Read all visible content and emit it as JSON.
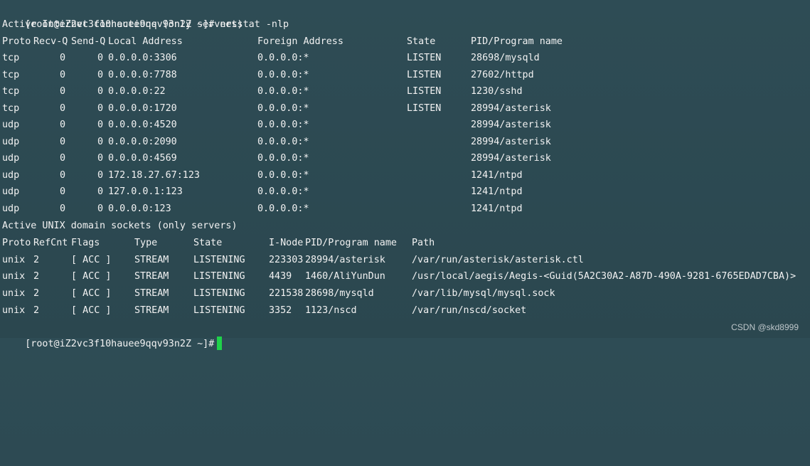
{
  "prompt": "[root@iZ2vc3f10hauee9qqv93n2Z ~]#",
  "command": "netstat -nlp",
  "inet_header": "Active Internet connections (only servers)",
  "inet_columns": [
    "Proto",
    "Recv-Q",
    "Send-Q",
    "Local Address",
    "Foreign Address",
    "State",
    "PID/Program name"
  ],
  "inet_rows": [
    [
      "tcp",
      "0",
      "0",
      "0.0.0.0:3306",
      "0.0.0.0:*",
      "LISTEN",
      "28698/mysqld"
    ],
    [
      "tcp",
      "0",
      "0",
      "0.0.0.0:7788",
      "0.0.0.0:*",
      "LISTEN",
      "27602/httpd"
    ],
    [
      "tcp",
      "0",
      "0",
      "0.0.0.0:22",
      "0.0.0.0:*",
      "LISTEN",
      "1230/sshd"
    ],
    [
      "tcp",
      "0",
      "0",
      "0.0.0.0:1720",
      "0.0.0.0:*",
      "LISTEN",
      "28994/asterisk"
    ],
    [
      "udp",
      "0",
      "0",
      "0.0.0.0:4520",
      "0.0.0.0:*",
      "",
      "28994/asterisk"
    ],
    [
      "udp",
      "0",
      "0",
      "0.0.0.0:2090",
      "0.0.0.0:*",
      "",
      "28994/asterisk"
    ],
    [
      "udp",
      "0",
      "0",
      "0.0.0.0:4569",
      "0.0.0.0:*",
      "",
      "28994/asterisk"
    ],
    [
      "udp",
      "0",
      "0",
      "172.18.27.67:123",
      "0.0.0.0:*",
      "",
      "1241/ntpd"
    ],
    [
      "udp",
      "0",
      "0",
      "127.0.0.1:123",
      "0.0.0.0:*",
      "",
      "1241/ntpd"
    ],
    [
      "udp",
      "0",
      "0",
      "0.0.0.0:123",
      "0.0.0.0:*",
      "",
      "1241/ntpd"
    ]
  ],
  "unix_header": "Active UNIX domain sockets (only servers)",
  "unix_columns": [
    "Proto",
    "RefCnt",
    "Flags",
    "Type",
    "State",
    "I-Node",
    "PID/Program name",
    "Path"
  ],
  "unix_rows": [
    [
      "unix",
      "2",
      "[ ACC ]",
      "STREAM",
      "LISTENING",
      "223303",
      "28994/asterisk",
      "/var/run/asterisk/asterisk.ctl"
    ],
    [
      "unix",
      "2",
      "[ ACC ]",
      "STREAM",
      "LISTENING",
      "4439",
      "1460/AliYunDun",
      "/usr/local/aegis/Aegis-<Guid(5A2C30A2-A87D-490A-9281-6765EDAD7CBA)>"
    ],
    [
      "unix",
      "2",
      "[ ACC ]",
      "STREAM",
      "LISTENING",
      "221538",
      "28698/mysqld",
      "/var/lib/mysql/mysql.sock"
    ],
    [
      "unix",
      "2",
      "[ ACC ]",
      "STREAM",
      "LISTENING",
      "3352",
      "1123/nscd",
      "/var/run/nscd/socket"
    ]
  ],
  "watermark": "CSDN @skd8999",
  "colors": {
    "background": "#2d4a52",
    "text": "#f2f2f2",
    "cursor": "#1fd24a"
  }
}
